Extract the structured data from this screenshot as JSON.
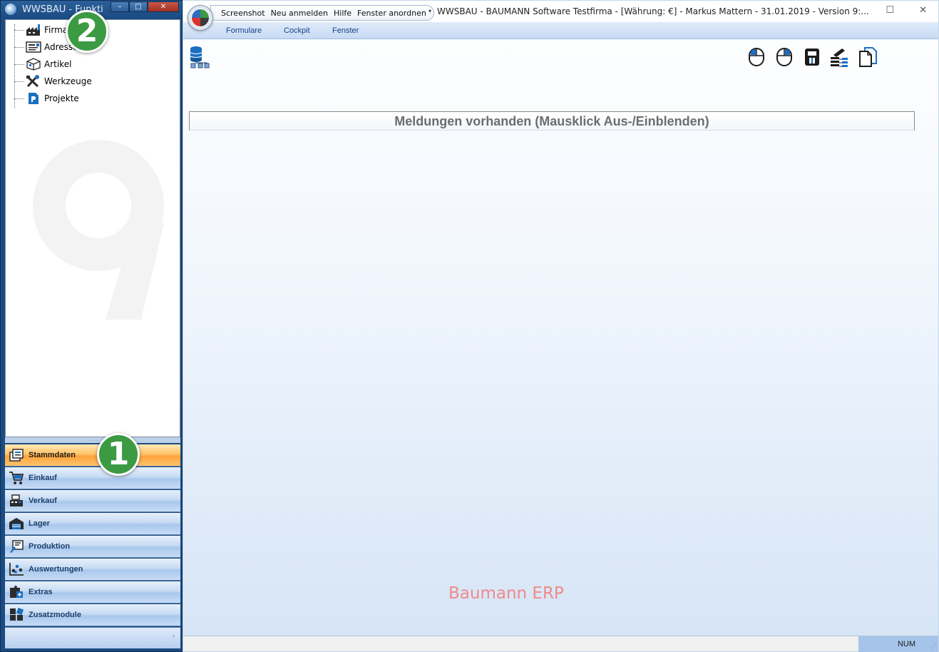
{
  "nav_window": {
    "title": "WWSBAU - Funkti",
    "tree_items": [
      {
        "label": "Firma",
        "icon": "factory-icon"
      },
      {
        "label": "Adressen",
        "icon": "address-card-icon"
      },
      {
        "label": "Artikel",
        "icon": "box-icon"
      },
      {
        "label": "Werkzeuge",
        "icon": "tools-icon"
      },
      {
        "label": "Projekte",
        "icon": "project-document-icon"
      }
    ],
    "splitter_grip": ".....",
    "categories": [
      {
        "label": "Stammdaten",
        "icon": "master-data-icon",
        "active": true
      },
      {
        "label": "Einkauf",
        "icon": "shopping-cart-icon",
        "active": false
      },
      {
        "label": "Verkauf",
        "icon": "cash-register-icon",
        "active": false
      },
      {
        "label": "Lager",
        "icon": "warehouse-icon",
        "active": false
      },
      {
        "label": "Produktion",
        "icon": "production-icon",
        "active": false
      },
      {
        "label": "Auswertungen",
        "icon": "analysis-icon",
        "active": false
      },
      {
        "label": "Extras",
        "icon": "puzzle-icon",
        "active": false
      },
      {
        "label": "Zusatzmodule",
        "icon": "modules-icon",
        "active": false
      }
    ],
    "footer_chevron": "ˇ",
    "window_buttons": {
      "minimize": "–",
      "maximize": "□",
      "close": "✕"
    }
  },
  "badges": {
    "one": "1",
    "two": "2"
  },
  "main_window": {
    "quick_access": [
      "Screenshot",
      "Neu anmelden",
      "Hilfe",
      "Fenster anordnen"
    ],
    "quick_access_dropdown": "▾",
    "caption": "WWSBAU - BAUMANN Software Testfirma - [Währung: €] -   Markus Mattern - 31.01.2019 - Version 9:...",
    "caption_buttons": {
      "maximize": "☐",
      "close": "✕"
    },
    "ribbon_tabs": [
      "Formulare",
      "Cockpit",
      "Fenster"
    ],
    "toolbar_right_icons": [
      "mouse-left-icon",
      "mouse-right-icon",
      "scanner-icon",
      "network-settings-icon",
      "copy-document-icon"
    ],
    "toolbar_left_icon": "database-tree-icon",
    "message_bar": "Meldungen vorhanden  (Mausklick Aus-/Einblenden)",
    "brand": "Baumann ERP",
    "status": {
      "num": "NUM",
      "grip": "⋰"
    }
  },
  "colors": {
    "nav_frame": "#1b4b82",
    "active_category": "#ffa43a",
    "badge_green": "#3c9a43",
    "brand_text": "#ef8a8a"
  }
}
